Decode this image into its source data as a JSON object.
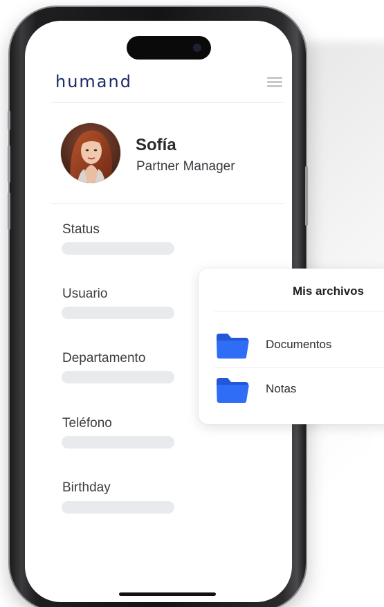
{
  "app": {
    "brand": "humand"
  },
  "profile": {
    "name": "Sofía",
    "role": "Partner Manager"
  },
  "fields": [
    {
      "label": "Status"
    },
    {
      "label": "Usuario"
    },
    {
      "label": "Departamento"
    },
    {
      "label": "Teléfono"
    },
    {
      "label": "Birthday"
    }
  ],
  "files_card": {
    "title": "Mis archivos",
    "items": [
      {
        "label": "Documentos",
        "icon": "folder-icon"
      },
      {
        "label": "Notas",
        "icon": "folder-icon"
      }
    ]
  },
  "colors": {
    "brand": "#1c2a6b",
    "folder": "#2f6df6",
    "placeholder_bar": "#e9eaee"
  }
}
